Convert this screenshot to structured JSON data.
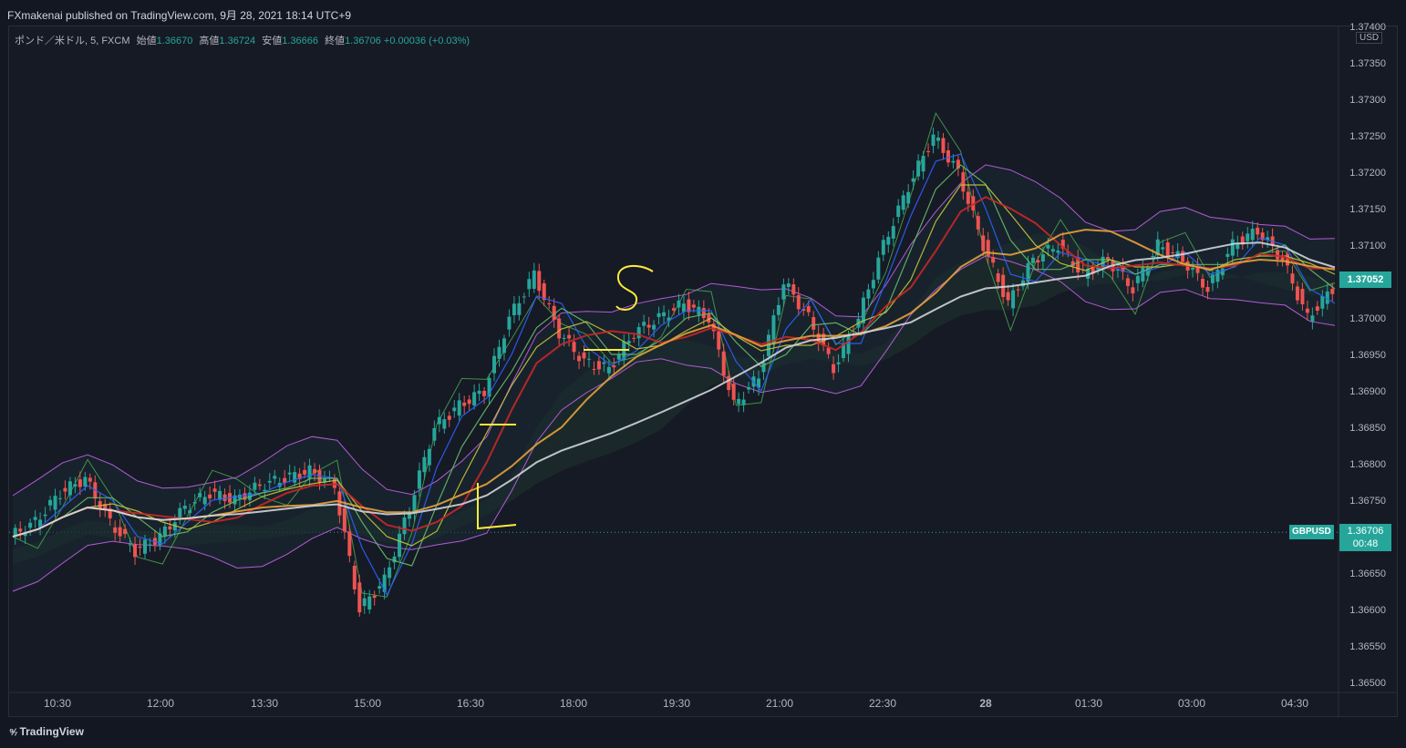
{
  "publisher_text": "FXmakenai published on TradingView.com, 9月 28, 2021 18:14 UTC+9",
  "legend": {
    "symbol": "ポンド／米ドル, 5, FXCM",
    "open_label": "始値",
    "open": "1.36670",
    "high_label": "高値",
    "high": "1.36724",
    "low_label": "安値",
    "low": "1.36666",
    "close_label": "終値",
    "close": "1.36706",
    "change": "+0.00036 (+0.03%)"
  },
  "currency_label": "USD",
  "current_price_label": "1.37052",
  "symbol_tag": "GBPUSD",
  "symbol_price": "1.36706",
  "countdown": "00:48",
  "branding": "TradingView",
  "colors": {
    "up": "#26a69a",
    "down": "#ef5350",
    "bg": "#131722",
    "pane": "#161a25"
  },
  "chart_data": {
    "type": "line",
    "yaxis_ticks": [
      "1.37400",
      "1.37350",
      "1.37300",
      "1.37250",
      "1.37200",
      "1.37150",
      "1.37100",
      "1.37050",
      "1.37000",
      "1.36950",
      "1.36900",
      "1.36850",
      "1.36800",
      "1.36750",
      "1.36700",
      "1.36650",
      "1.36600",
      "1.36550",
      "1.36500"
    ],
    "xaxis_ticks": [
      "10:30",
      "12:00",
      "13:30",
      "15:00",
      "16:30",
      "18:00",
      "19:30",
      "21:00",
      "22:30",
      "28",
      "01:30",
      "03:00",
      "04:30"
    ],
    "ylim": [
      1.3648,
      1.3741
    ],
    "series": [
      {
        "values": [
          1.367,
          1.3672,
          1.3676,
          1.3678,
          1.3672,
          1.3668,
          1.367,
          1.3674,
          1.3676,
          1.3675,
          1.3677,
          1.3678,
          1.3679,
          1.3677,
          1.366,
          1.3664,
          1.3674,
          1.3685,
          1.3688,
          1.369,
          1.37,
          1.3706,
          1.3698,
          1.3694,
          1.3693,
          1.3698,
          1.37,
          1.3702,
          1.37,
          1.3688,
          1.3692,
          1.3705,
          1.37,
          1.3693,
          1.37,
          1.371,
          1.3718,
          1.3725,
          1.372,
          1.371,
          1.3702,
          1.3708,
          1.371,
          1.3706,
          1.3708,
          1.3704,
          1.371,
          1.3708,
          1.3704,
          1.371,
          1.3712,
          1.3708,
          1.37,
          1.3704
        ]
      }
    ]
  }
}
